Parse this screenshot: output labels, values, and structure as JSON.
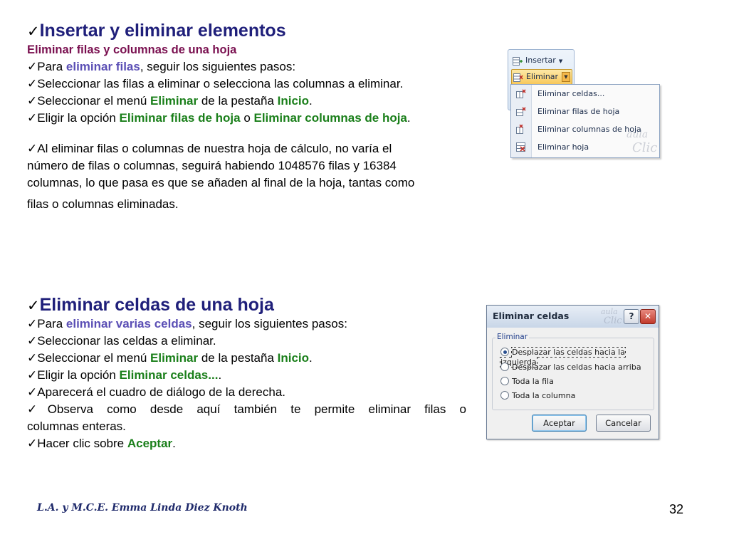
{
  "section1": {
    "title": "Insertar y eliminar elementos",
    "subtitle": "Eliminar filas y columnas de una hoja",
    "bullets": [
      {
        "pre": "Para ",
        "em": "eliminar filas",
        "post": ", seguir los siguientes pasos:"
      },
      {
        "text": "Seleccionar las filas a eliminar o selecciona las columnas a eliminar."
      },
      {
        "pre": "Seleccionar el menú ",
        "em1": "Eliminar",
        "mid": " de la pestaña ",
        "em2": "Inicio",
        "post": "."
      },
      {
        "pre": "Eligir la opción ",
        "em1": "Eliminar filas de hoja",
        "mid": " o ",
        "em2": "Eliminar columnas de hoja",
        "post": "."
      }
    ],
    "paragraph_lines": [
      "Al eliminar filas o columnas de nuestra hoja de cálculo, no varía el",
      "número de filas o columnas, seguirá habiendo 1048576 filas y 16384",
      "columnas, lo que pasa es que se añaden al final de la hoja, tantas como",
      "filas o columnas eliminadas."
    ]
  },
  "section2": {
    "title": "Eliminar celdas de una hoja",
    "bullets": [
      {
        "pre": "Para ",
        "em": "eliminar varias celdas",
        "post": ", seguir los siguientes pasos:"
      },
      {
        "text": "Seleccionar las celdas a eliminar."
      },
      {
        "pre": "Seleccionar el menú ",
        "em1": "Eliminar",
        "mid": " de la pestaña ",
        "em2": "Inicio",
        "post": "."
      },
      {
        "pre": "Eligir la opción ",
        "em": "Eliminar celdas...",
        "post": "."
      },
      {
        "text": "Aparecerá el cuadro de diálogo de la derecha."
      },
      {
        "line1": "Observa como desde aquí también te permite eliminar filas o",
        "line2": "columnas enteras."
      },
      {
        "pre": "Hacer clic sobre ",
        "em": "Aceptar",
        "post": "."
      }
    ]
  },
  "ribbon": {
    "insert_label": "Insertar",
    "delete_label": "Eliminar",
    "menu_items": [
      "Eliminar celdas...",
      "Eliminar filas de hoja",
      "Eliminar columnas de hoja",
      "Eliminar hoja"
    ],
    "watermark_top": "aula",
    "watermark_bottom": "Clic"
  },
  "dialog": {
    "title": "Eliminar celdas",
    "help": "?",
    "close": "✕",
    "group_label": "Eliminar",
    "options": [
      "Desplazar las celdas hacia la izquierda",
      "Desplazar las celdas hacia arriba",
      "Toda la fila",
      "Toda la columna"
    ],
    "selected_index": 0,
    "ok_label": "Aceptar",
    "cancel_label": "Cancelar",
    "watermark_top": "aula",
    "watermark_bottom": "Clic"
  },
  "checkmark": "✓",
  "footer": {
    "author": "L.A. y M.C.E. Emma Linda Diez Knoth",
    "page_number": "32"
  },
  "colors": {
    "title": "#1f1f7a",
    "subtitle": "#7a1050",
    "blue_emphasis": "#5b4fb5",
    "green_emphasis": "#1a7f1a"
  }
}
